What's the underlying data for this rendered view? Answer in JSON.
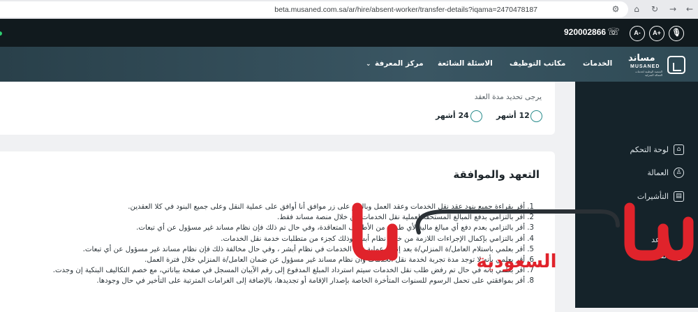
{
  "browser": {
    "url": "beta.musaned.com.sa/ar/hire/absent-worker/transfer-details?iqama=2470478187"
  },
  "topbar": {
    "phone": "920002866",
    "font_decrease": "A-",
    "font_increase": "A+"
  },
  "nav": {
    "logo_ar": "مساند",
    "logo_en": "MUSANED",
    "logo_sub": "المنصة الوطنية لخدمات العمالة المنزلية",
    "items": [
      "الخدمات",
      "مكاتب التوظيف",
      "الاسئلة الشائعة",
      "مركز المعرفة"
    ]
  },
  "sidebar": {
    "items": [
      "لوحة التحكم",
      "العمالة",
      "التأشيرات",
      "ساعد",
      "الفت"
    ]
  },
  "contract": {
    "prompt": "يرجى تحديد مدة العقد",
    "options": [
      "12 أشهر",
      "24 أشهر"
    ]
  },
  "pledge": {
    "title": "التعهد والموافقة",
    "items": [
      "1. أقر بقراءة جميع بنود عقد نقل الخدمات وعقد العمل وبالنقر على زر موافق أنا أوافق على عملية النقل وعلى جميع البنود في كلا العقدين.",
      "2. أقر بالتزامي بدفع المبالغ المستحقة لعملية نقل الخدمات من خلال منصة مساند فقط.",
      "3. أقر بالتزامي بعدم دفع أي مبالغ مالية لأي طرف من الأطراف المتعاقدة، وفي حال تم ذلك فإن نظام مساند غير مسؤول عن أي تبعات.",
      "4. أقر بالتزامي بإكمال الإجراءات اللازمة من خلال نظام أبشر وذلك كجزء من متطلبات خدمة نقل الخدمات.",
      "5. أقر بعلمي باستلام العامل/ة المنزلي/ة بعد إتمام عملية نقل الخدمات في نظام أبشر ، وفي حال مخالفة ذلك فإن نظام مساند غير مسؤول عن أي تبعات.",
      "6. أقر بعلمي بأنه لا توجد مدة تجربة لخدمة نقل الخدمات وأن نظام مساند غير مسؤول عن ضمان العامل/ة المنزلي خلال فترة العمل.",
      "7. أقر بعلمي بأنه في حال تم رفض طلب نقل الخدمات سيتم استرداد المبلغ المدفوع إلى رقم الآيبان المسجل في صفحة بياناتي، مع خصم التكاليف البنكية إن وجدت.",
      "8. أقر بموافقتي على تحمل الرسوم للسنوات المتأخرة الخاصة بإصدار الإقامة أو تجديدها، بالإضافة إلى الغرامات المترتبة على التأخير في حال وجودها."
    ]
  },
  "watermark": {
    "text": "السعودية"
  },
  "colors": {
    "nav_dark": "#111a1e",
    "nav_gradient": "#3a5663",
    "sidebar": "#15232a",
    "radio_accent": "#2a8c8c",
    "watermark_red": "#e0232b"
  }
}
